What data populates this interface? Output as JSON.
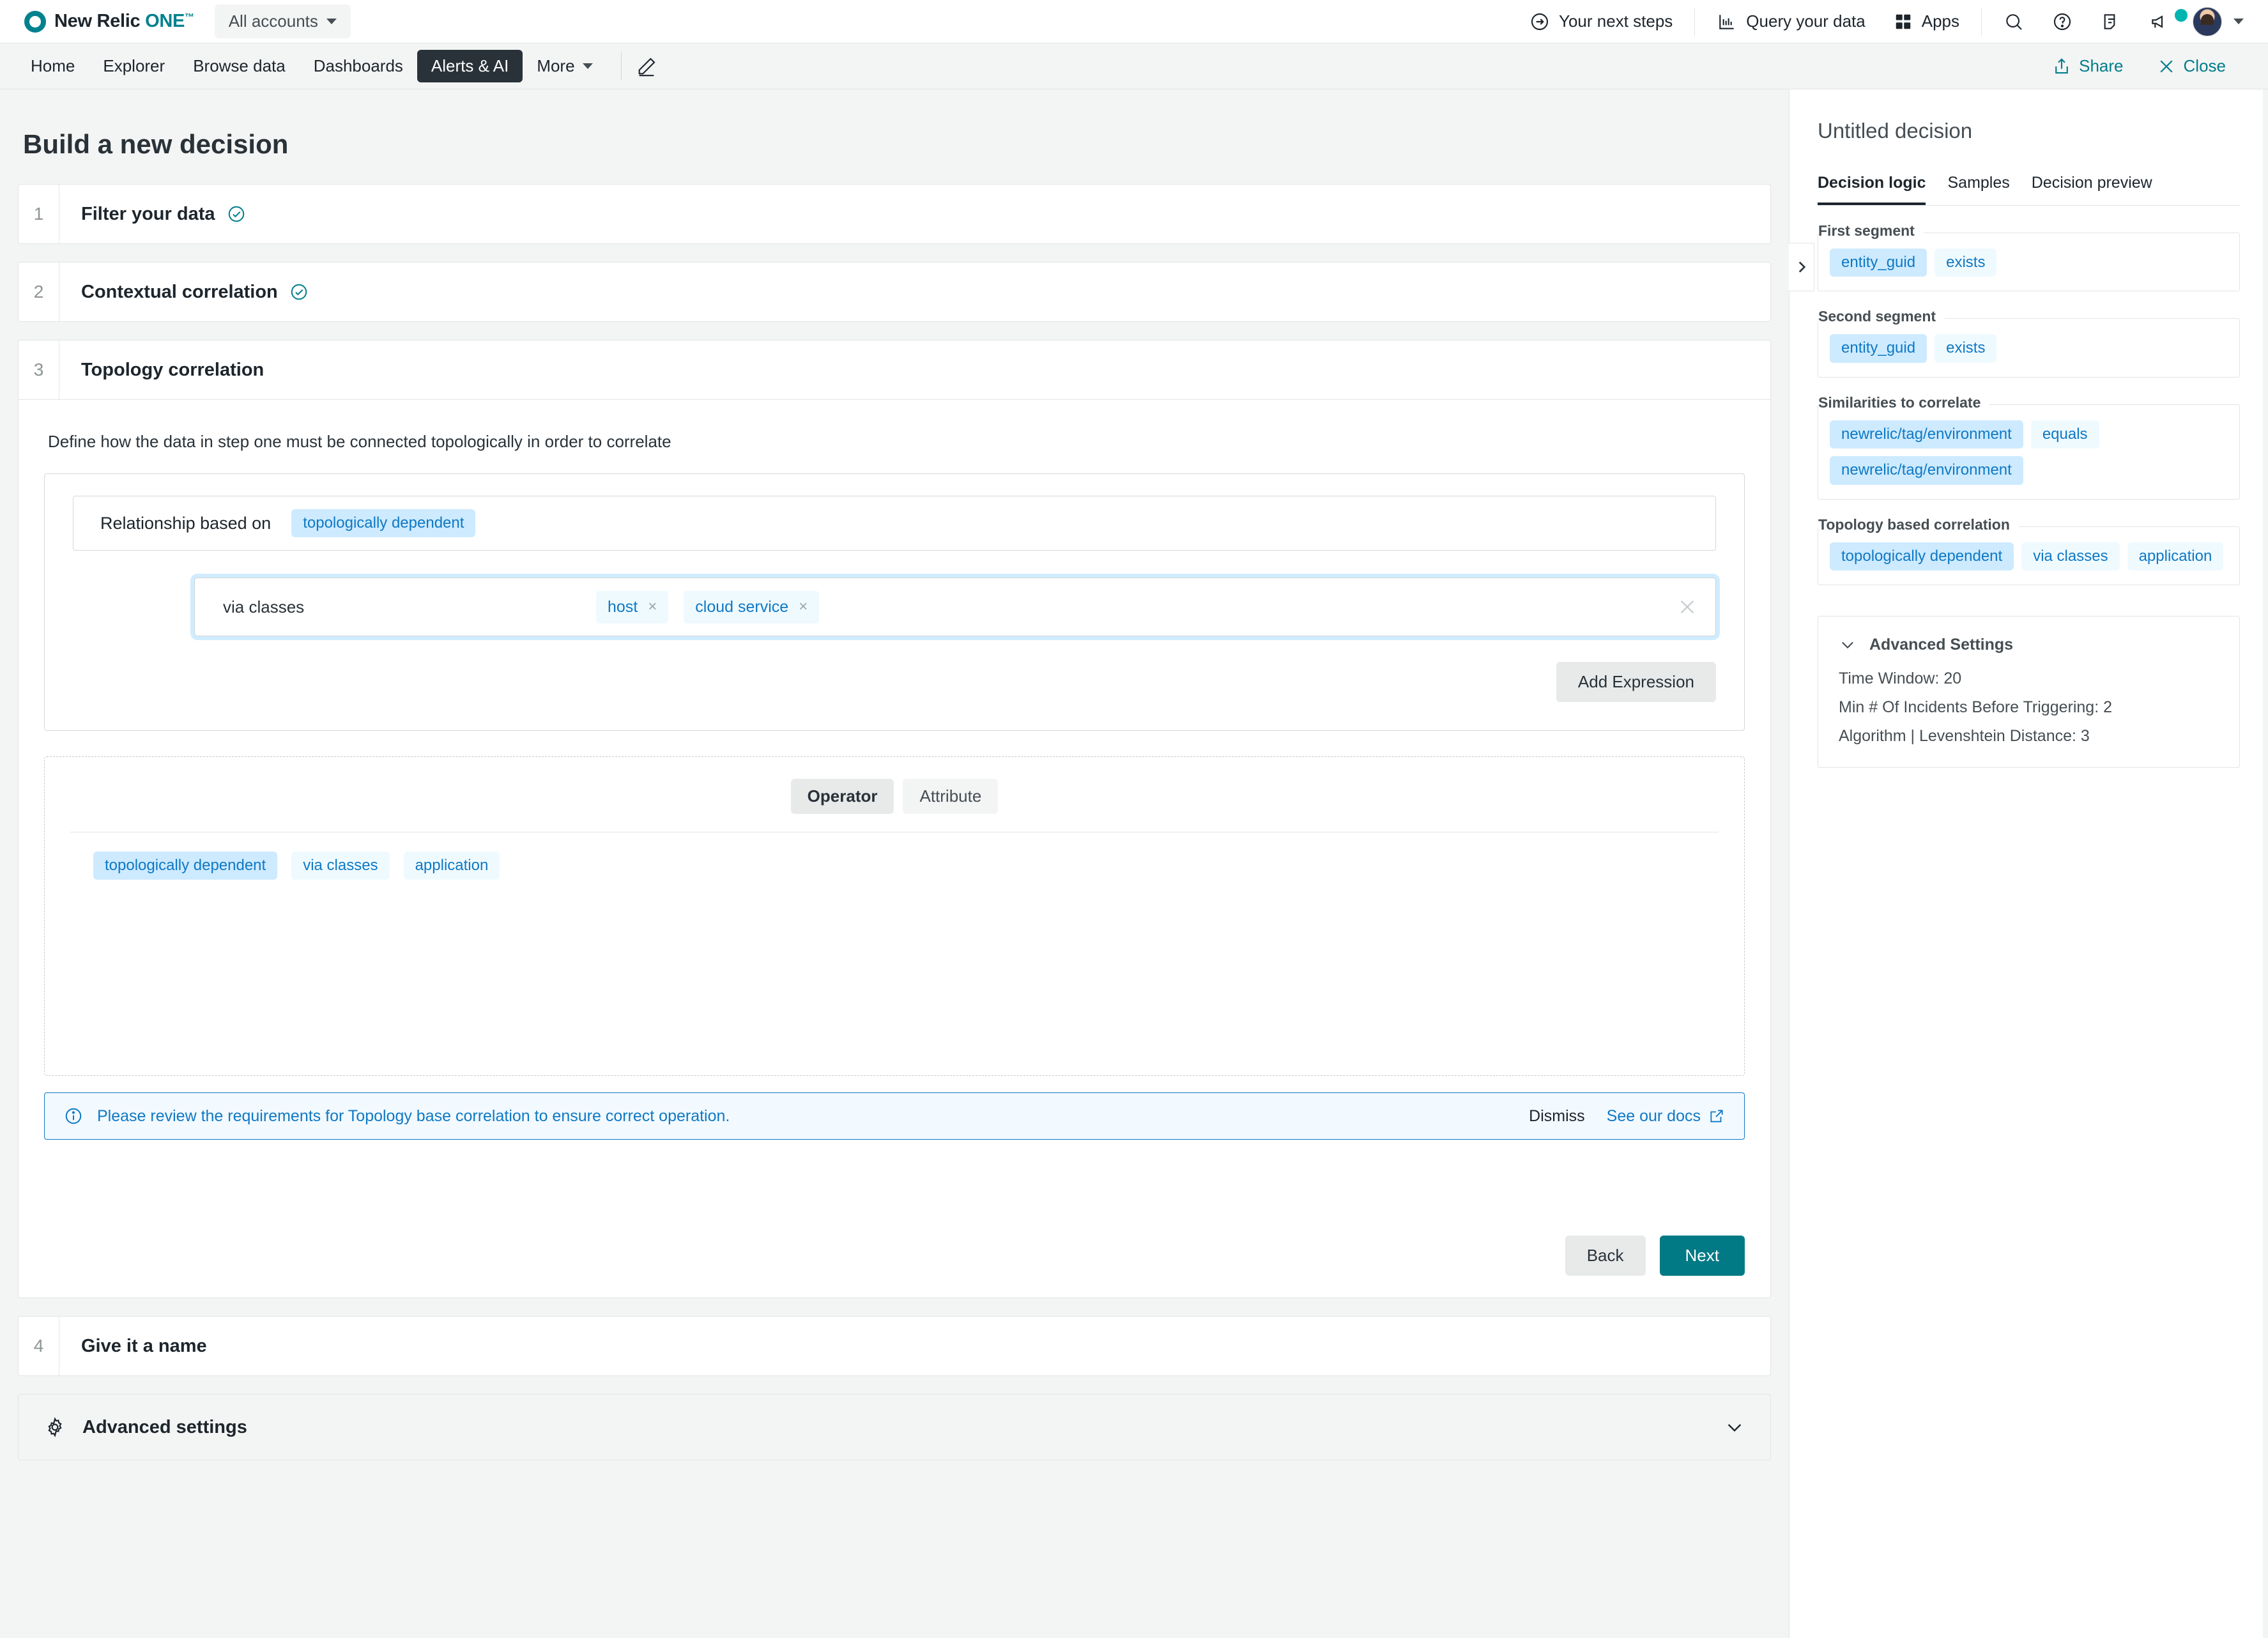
{
  "topbar": {
    "brand_new": "New Relic ",
    "brand_one": "ONE",
    "account_selector": "All accounts",
    "next_steps": "Your next steps",
    "query_data": "Query your data",
    "apps": "Apps"
  },
  "nav": {
    "items": [
      {
        "label": "Home",
        "active": false
      },
      {
        "label": "Explorer",
        "active": false
      },
      {
        "label": "Browse data",
        "active": false
      },
      {
        "label": "Dashboards",
        "active": false
      },
      {
        "label": "Alerts & AI",
        "active": true
      },
      {
        "label": "More",
        "active": false
      }
    ],
    "share": "Share",
    "close": "Close"
  },
  "page": {
    "title": "Build a new decision"
  },
  "steps": [
    {
      "num": "1",
      "title": "Filter your data",
      "complete": true
    },
    {
      "num": "2",
      "title": "Contextual correlation",
      "complete": true
    },
    {
      "num": "3",
      "title": "Topology correlation",
      "complete": false
    },
    {
      "num": "4",
      "title": "Give it a name",
      "complete": false
    }
  ],
  "topology": {
    "description": "Define how the data in step one must be connected topologically in order to correlate",
    "relationship_label": "Relationship based on",
    "relationship_value": "topologically dependent",
    "expression_label": "via classes",
    "expression_chips": [
      {
        "label": "host",
        "remove": "×"
      },
      {
        "label": "cloud service",
        "remove": "×"
      }
    ],
    "add_expression": "Add Expression",
    "preview_tabs": [
      {
        "label": "Operator",
        "active": true
      },
      {
        "label": "Attribute",
        "active": false
      }
    ],
    "preview_tokens": [
      {
        "label": "topologically dependent",
        "style": "strong"
      },
      {
        "label": "via classes",
        "style": "light"
      },
      {
        "label": "application",
        "style": "light"
      }
    ],
    "notice": {
      "text": "Please review the requirements for Topology base correlation to ensure correct operation.",
      "dismiss": "Dismiss",
      "docs": "See our docs"
    },
    "back": "Back",
    "next": "Next"
  },
  "advanced_section": {
    "title": "Advanced settings"
  },
  "sidebar": {
    "title": "Untitled decision",
    "tabs": [
      {
        "label": "Decision logic",
        "active": true
      },
      {
        "label": "Samples",
        "active": false
      },
      {
        "label": "Decision preview",
        "active": false
      }
    ],
    "fieldsets": [
      {
        "legend": "First segment",
        "rows": [
          [
            {
              "label": "entity_guid",
              "style": "strong"
            },
            {
              "label": "exists",
              "style": "light"
            }
          ]
        ]
      },
      {
        "legend": "Second segment",
        "rows": [
          [
            {
              "label": "entity_guid",
              "style": "strong"
            },
            {
              "label": "exists",
              "style": "light"
            }
          ]
        ]
      },
      {
        "legend": "Similarities to correlate",
        "rows": [
          [
            {
              "label": "newrelic/tag/environment",
              "style": "strong"
            },
            {
              "label": "equals",
              "style": "light"
            }
          ],
          [
            {
              "label": "newrelic/tag/environment",
              "style": "strong"
            }
          ]
        ]
      },
      {
        "legend": "Topology based correlation",
        "rows": [
          [
            {
              "label": "topologically dependent",
              "style": "strong"
            },
            {
              "label": "via classes",
              "style": "light"
            },
            {
              "label": "application",
              "style": "light"
            }
          ]
        ]
      }
    ],
    "advanced": {
      "title": "Advanced Settings",
      "lines": [
        "Time Window: 20",
        "Min # Of Incidents Before Triggering: 2",
        "Algorithm | Levenshtein Distance: 3"
      ]
    }
  },
  "colors": {
    "teal": "#017a85",
    "dark": "#293238",
    "token_blue": "#0f79c4",
    "notice_blue": "#0f79c4"
  }
}
